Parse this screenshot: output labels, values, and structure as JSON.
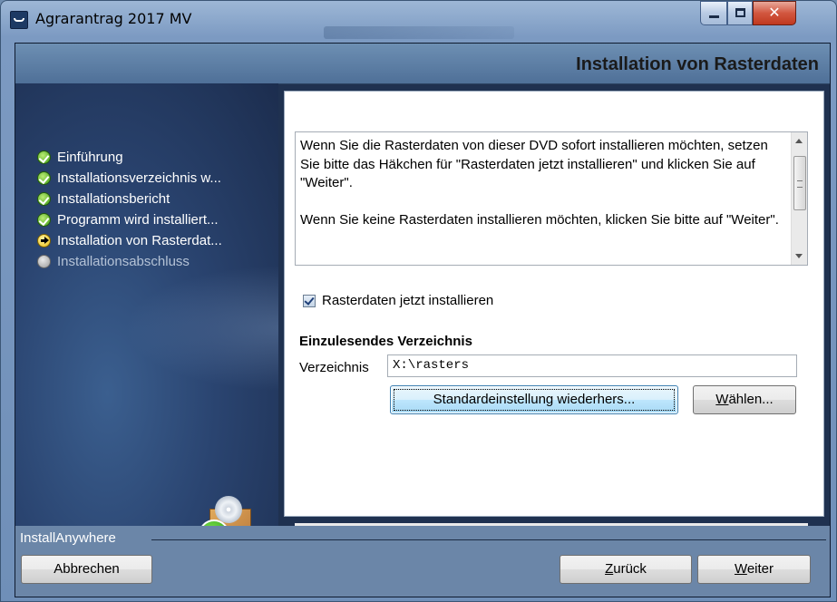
{
  "window": {
    "title": "Agrarantrag 2017 MV",
    "caption_buttons": [
      "minimize",
      "maximize",
      "close"
    ],
    "close_glyph": "✕"
  },
  "header": {
    "title": "Installation von Rasterdaten"
  },
  "steps": [
    {
      "label": "Einführung",
      "state": "done",
      "icon": "check-icon"
    },
    {
      "label": "Installationsverzeichnis w...",
      "state": "done",
      "icon": "check-icon"
    },
    {
      "label": "Installationsbericht",
      "state": "done",
      "icon": "check-icon"
    },
    {
      "label": "Programm wird installiert...",
      "state": "done",
      "icon": "check-icon"
    },
    {
      "label": "Installation von Rasterdat...",
      "state": "current",
      "icon": "arrow-right-icon"
    },
    {
      "label": "Installationsabschluss",
      "state": "pending",
      "icon": "circle-icon"
    }
  ],
  "info": {
    "paragraph1": "Wenn Sie die Rasterdaten von dieser DVD sofort installieren möchten, setzen Sie bitte das Häkchen für \"Rasterdaten jetzt installieren\" und klicken Sie auf \"Weiter\".",
    "paragraph2": "Wenn Sie keine Rasterdaten installieren möchten, klicken Sie bitte auf \"Weiter\"."
  },
  "checkbox": {
    "label": "Rasterdaten jetzt installieren",
    "checked": true
  },
  "directory": {
    "section_title": "Einzulesendes Verzeichnis",
    "label": "Verzeichnis",
    "value": "X:\\rasters",
    "default_button": "Standardeinstellung wiederhers...",
    "choose_button_mnemonic": "W",
    "choose_button_rest": "ählen..."
  },
  "footer": {
    "brand": "InstallAnywhere",
    "cancel": "Abbrechen",
    "back_mnemonic": "Z",
    "back_rest": "urück",
    "next_mnemonic": "W",
    "next_rest": "eiter"
  }
}
